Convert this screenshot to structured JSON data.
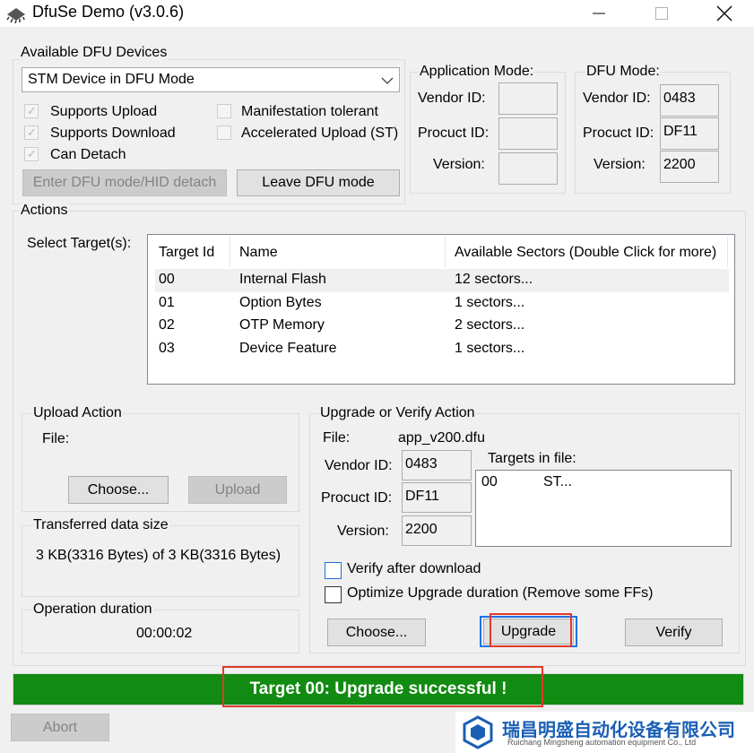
{
  "window": {
    "title": "DfuSe Demo (v3.0.6)",
    "app_icon": "chip-icon",
    "controls": [
      "minimize-icon",
      "maximize-icon",
      "close-icon"
    ]
  },
  "devices": {
    "group_label": "Available DFU Devices",
    "selected_device": "STM Device in DFU Mode",
    "checkboxes": {
      "supports_upload": "Supports Upload",
      "supports_download": "Supports Download",
      "can_detach": "Can Detach",
      "manifestation_tolerant": "Manifestation tolerant",
      "accelerated_upload": "Accelerated Upload (ST)"
    },
    "enter_dfu_button": "Enter DFU mode/HID detach",
    "leave_dfu_button": "Leave DFU mode"
  },
  "application_mode": {
    "label": "Application Mode:",
    "vendor_id_label": "Vendor ID:",
    "product_id_label": "Procuct ID:",
    "version_label": "Version:",
    "vendor_id": "",
    "product_id": "",
    "version": ""
  },
  "dfu_mode": {
    "label": "DFU Mode:",
    "vendor_id_label": "Vendor ID:",
    "product_id_label": "Procuct ID:",
    "version_label": "Version:",
    "vendor_id": "0483",
    "product_id": "DF11",
    "version": "2200"
  },
  "actions": {
    "group_label": "Actions",
    "select_targets_label": "Select Target(s):",
    "columns": [
      "Target Id",
      "Name",
      "Available Sectors (Double Click for more)"
    ],
    "targets": [
      {
        "id": "00",
        "name": "Internal Flash",
        "sectors": "12 sectors..."
      },
      {
        "id": "01",
        "name": "Option Bytes",
        "sectors": "1 sectors..."
      },
      {
        "id": "02",
        "name": "OTP Memory",
        "sectors": "2 sectors..."
      },
      {
        "id": "03",
        "name": "Device Feature",
        "sectors": "1 sectors..."
      }
    ]
  },
  "upload": {
    "group_label": "Upload Action",
    "file_label": "File:",
    "choose_button": "Choose...",
    "upload_button": "Upload"
  },
  "transfer": {
    "group_label": "Transferred data size",
    "value": "3 KB(3316 Bytes) of 3 KB(3316 Bytes)"
  },
  "duration": {
    "group_label": "Operation duration",
    "value": "00:00:02"
  },
  "upgrade": {
    "group_label": "Upgrade or Verify Action",
    "file_label": "File:",
    "file_name": "app_v200.dfu",
    "vendor_id_label": "Vendor ID:",
    "product_id_label": "Procuct ID:",
    "version_label": "Version:",
    "vendor_id": "0483",
    "product_id": "DF11",
    "version": "2200",
    "targets_in_file_label": "Targets in file:",
    "target_in_file_id": "00",
    "target_in_file_name": "ST...",
    "verify_after_download": "Verify after download",
    "optimize_upgrade": "Optimize Upgrade duration (Remove some FFs)",
    "choose_button": "Choose...",
    "upgrade_button": "Upgrade",
    "verify_button": "Verify"
  },
  "status": {
    "message": "Target 00: Upgrade successful !",
    "color": "#118b11"
  },
  "abort_button": "Abort",
  "watermark": {
    "company_cn": "瑞昌明盛自动化设备有限公司",
    "company_en": "Ruichang Mingsheng automation equipment Co., Ltd",
    "logo": "hexagon-logo-icon"
  },
  "colors": {
    "highlight_red": "#e03a2a",
    "highlight_blue": "#1e72e6",
    "brand_blue": "#1a5fb4"
  }
}
